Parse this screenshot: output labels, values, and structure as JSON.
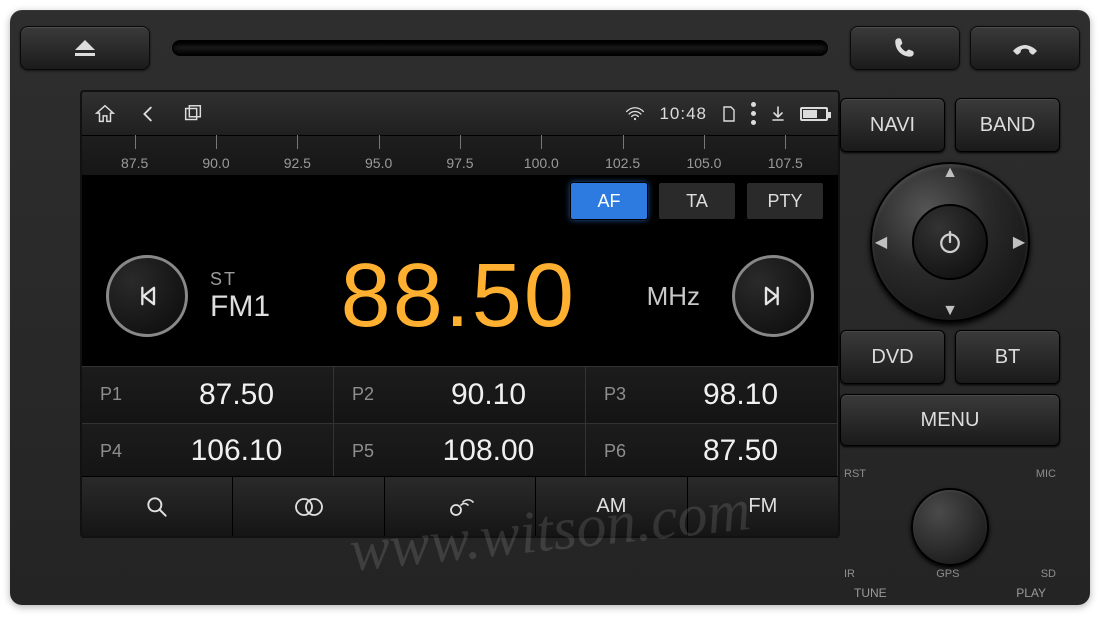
{
  "statusbar": {
    "clock": "10:48",
    "icons": {
      "wifi": "wifi-icon",
      "battery_pct": 60
    }
  },
  "ruler": [
    "87.5",
    "90.0",
    "92.5",
    "95.0",
    "97.5",
    "100.0",
    "102.5",
    "105.0",
    "107.5"
  ],
  "modes": {
    "af": "AF",
    "ta": "TA",
    "pty": "PTY",
    "active": "af"
  },
  "band": {
    "stereo": "ST",
    "name": "FM1"
  },
  "frequency": "88.50",
  "freq_unit": "MHz",
  "presets": [
    {
      "slot": "P1",
      "value": "87.50"
    },
    {
      "slot": "P2",
      "value": "90.10"
    },
    {
      "slot": "P3",
      "value": "98.10"
    },
    {
      "slot": "P4",
      "value": "106.10"
    },
    {
      "slot": "P5",
      "value": "108.00"
    },
    {
      "slot": "P6",
      "value": "87.50"
    }
  ],
  "softbar": {
    "am": "AM",
    "fm": "FM"
  },
  "side": {
    "navi": "NAVI",
    "band": "BAND",
    "dvd": "DVD",
    "bt": "BT",
    "menu": "MENU"
  },
  "ports": {
    "rst": "RST",
    "mic": "MIC",
    "ir": "IR",
    "gps": "GPS",
    "sd": "SD",
    "tune": "TUNE",
    "play": "PLAY"
  },
  "watermark": "www.witson.com"
}
